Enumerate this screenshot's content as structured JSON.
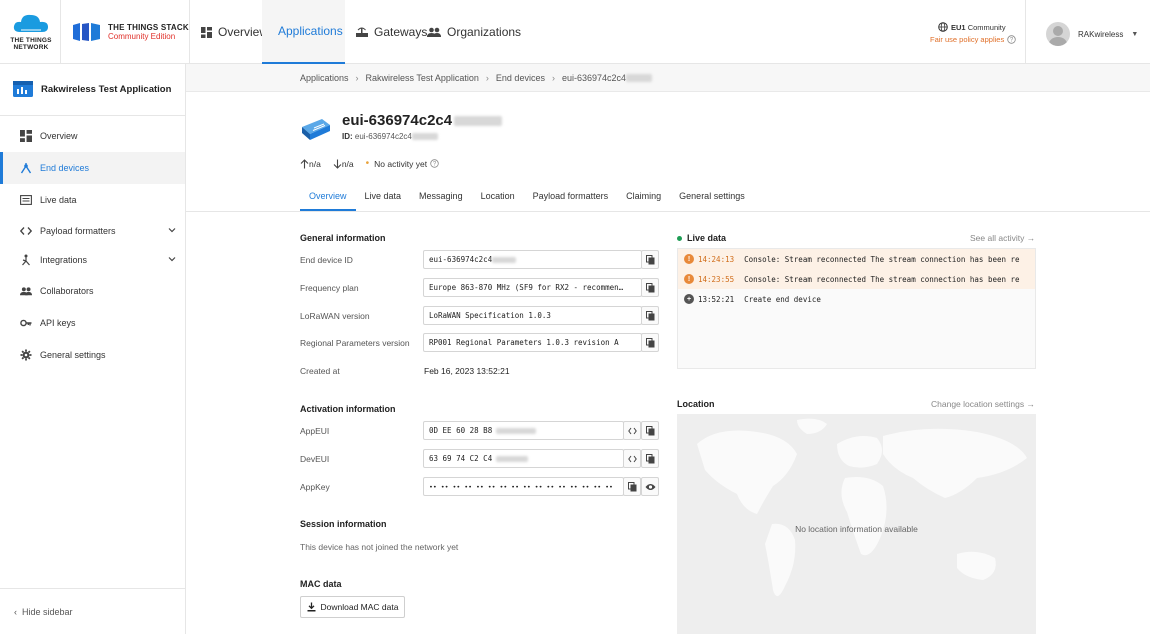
{
  "header": {
    "ttn_logo_text": [
      "THE THINGS",
      "NETWORK"
    ],
    "stack_title": "THE THINGS STACK",
    "stack_edition": "Community Edition",
    "nav": [
      {
        "label": "Overview",
        "icon": "grid-icon"
      },
      {
        "label": "Applications",
        "icon": "window-icon",
        "active": true
      },
      {
        "label": "Gateways",
        "icon": "gateway-icon"
      },
      {
        "label": "Organizations",
        "icon": "people-icon"
      }
    ],
    "cluster": {
      "region": "EU1",
      "label": "Community",
      "policy": "Fair use policy applies"
    },
    "user": {
      "name": "RAKwireless"
    }
  },
  "sidebar": {
    "app_name": "Rakwireless Test Application",
    "items": [
      {
        "label": "Overview",
        "icon": "grid-icon"
      },
      {
        "label": "End devices",
        "icon": "devices-icon",
        "active": true
      },
      {
        "label": "Live data",
        "icon": "list-icon"
      },
      {
        "label": "Payload formatters",
        "icon": "code-icon",
        "expandable": true
      },
      {
        "label": "Integrations",
        "icon": "integration-icon",
        "expandable": true
      },
      {
        "label": "Collaborators",
        "icon": "people-icon"
      },
      {
        "label": "API keys",
        "icon": "key-icon"
      },
      {
        "label": "General settings",
        "icon": "gear-icon"
      }
    ],
    "hide_label": "Hide sidebar"
  },
  "breadcrumb": [
    "Applications",
    "Rakwireless Test Application",
    "End devices",
    "eui-636974c2c4"
  ],
  "device": {
    "title": "eui-636974c2c4",
    "id_label": "ID:",
    "id_value": "eui-636974c2c4",
    "uplink": "n/a",
    "downlink": "n/a",
    "activity": "No activity yet"
  },
  "tabs": [
    "Overview",
    "Live data",
    "Messaging",
    "Location",
    "Payload formatters",
    "Claiming",
    "General settings"
  ],
  "general": {
    "title": "General information",
    "fields": [
      {
        "label": "End device ID",
        "value": "eui-636974c2c4"
      },
      {
        "label": "Frequency plan",
        "value": "Europe 863-870 MHz (SF9 for RX2 - recommen…"
      },
      {
        "label": "LoRaWAN version",
        "value": "LoRaWAN Specification 1.0.3"
      },
      {
        "label": "Regional Parameters version",
        "value": "RP001 Regional Parameters 1.0.3 revision A"
      }
    ],
    "created_label": "Created at",
    "created_value": "Feb 16, 2023 13:52:21"
  },
  "activation": {
    "title": "Activation information",
    "fields": [
      {
        "label": "AppEUI",
        "value": "0D EE 60 28 B8"
      },
      {
        "label": "DevEUI",
        "value": "63 69 74 C2 C4"
      },
      {
        "label": "AppKey",
        "value": "•• •• •• •• •• •• •• •• •• •• •• •• •• •• •• ••"
      }
    ]
  },
  "session": {
    "title": "Session information",
    "text": "This device has not joined the network yet"
  },
  "mac": {
    "title": "MAC data",
    "button": "Download MAC data"
  },
  "live": {
    "title": "Live data",
    "see_all": "See all activity →",
    "events": [
      {
        "time": "14:24:13",
        "text": "Console: Stream reconnected  The stream connection has been re",
        "level": "warn"
      },
      {
        "time": "14:23:55",
        "text": "Console: Stream reconnected  The stream connection has been re",
        "level": "warn"
      },
      {
        "time": "13:52:21",
        "text": "Create end device",
        "level": "create"
      }
    ]
  },
  "location": {
    "title": "Location",
    "change": "Change location settings →",
    "empty": "No location information available"
  },
  "colors": {
    "accent": "#1f7bd8",
    "warning": "#e8893a",
    "brand_red": "#e0302a"
  }
}
